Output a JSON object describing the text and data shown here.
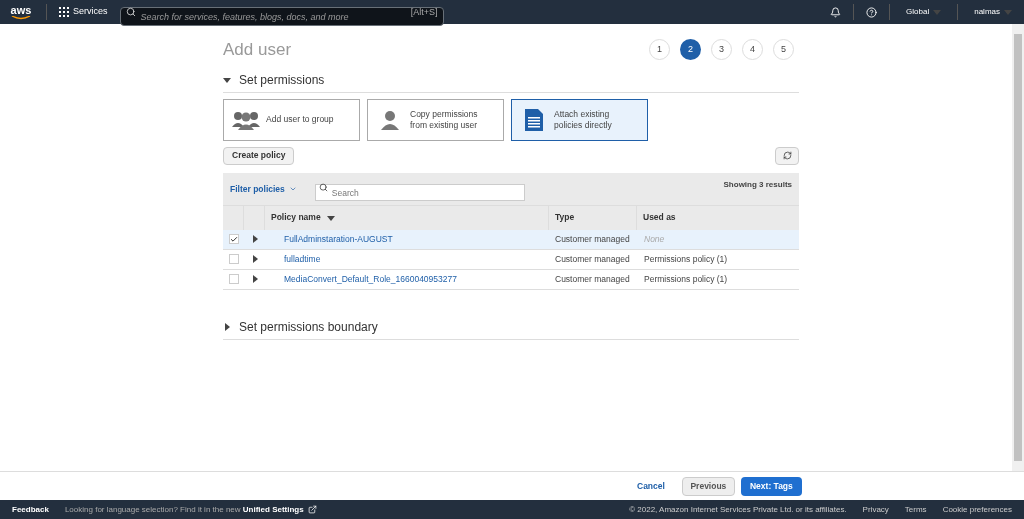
{
  "top_bar": {
    "logo": "aws",
    "services": "Services",
    "search": {
      "placeholder": "Search for services, features, blogs, docs, and more",
      "shortcut": "[Alt+S]"
    },
    "region": "Global",
    "account": "nalmas"
  },
  "page": {
    "title": "Add user",
    "steps": [
      {
        "label": "1",
        "selected": false
      },
      {
        "label": "2",
        "selected": true
      },
      {
        "label": "3",
        "selected": false
      },
      {
        "label": "4",
        "selected": false
      },
      {
        "label": "5",
        "selected": false
      }
    ],
    "section": {
      "title": "Set permissions",
      "expanded": true
    },
    "options": [
      {
        "kind": "group",
        "label": "Add user to group",
        "selected": false
      },
      {
        "kind": "user",
        "label": "Copy permissions from existing user",
        "selected": false
      },
      {
        "kind": "document",
        "label": "Attach existing policies directly",
        "selected": true
      }
    ],
    "create_policy": "Create policy",
    "filter": "Filter policies",
    "search": {
      "placeholder": "Search"
    },
    "results": "Showing 3 results",
    "table": {
      "columns": [
        "Policy name",
        "Type",
        "Used as"
      ],
      "rows": [
        {
          "checked": true,
          "name": "FullAdminstaration-AUGUST",
          "type": "Customer managed",
          "used_as": "None",
          "empty": true
        },
        {
          "checked": false,
          "name": "fulladtime",
          "type": "Customer managed",
          "used_as": "Permissions policy (1)",
          "empty": false
        },
        {
          "checked": false,
          "name": "MediaConvert_Default_Role_1660040953277",
          "type": "Customer managed",
          "used_as": "Permissions policy (1)",
          "empty": false
        }
      ]
    },
    "boundary": {
      "title": "Set permissions boundary",
      "expanded": false
    }
  },
  "actions": {
    "cancel": "Cancel",
    "previous": "Previous",
    "next": "Next: Tags"
  },
  "footer": {
    "feedback": "Feedback",
    "note": "Looking for language selection? Find it in the new **Unified Settings**",
    "copyright": "© 2022, Amazon Internet Services Private Ltd. or its affiliates.",
    "links": [
      "Privacy",
      "Terms",
      "Cookie preferences"
    ]
  }
}
